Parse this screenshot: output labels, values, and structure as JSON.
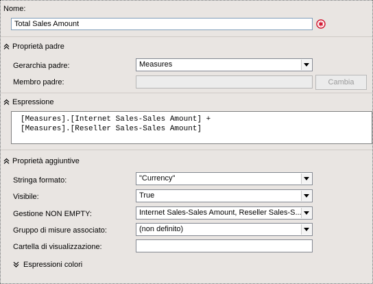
{
  "name_section": {
    "label": "Nome:",
    "value": "Total Sales Amount"
  },
  "parent_section": {
    "header": "Proprietà padre",
    "gerarchia_label": "Gerarchia padre:",
    "gerarchia_value": "Measures",
    "membro_label": "Membro padre:",
    "membro_value": "",
    "change_button": "Cambia"
  },
  "expression_section": {
    "header": "Espressione",
    "line1": "[Measures].[Internet Sales-Sales Amount] +",
    "line2": "[Measures].[Reseller Sales-Sales Amount]"
  },
  "additional_section": {
    "header": "Proprietà aggiuntive",
    "format_label": "Stringa formato:",
    "format_value": "\"Currency\"",
    "visible_label": "Visibile:",
    "visible_value": "True",
    "nonempty_label": "Gestione NON EMPTY:",
    "nonempty_value": "Internet Sales-Sales Amount, Reseller Sales-S...",
    "group_label": "Gruppo di misure associato:",
    "group_value": "(non definito)",
    "folder_label": "Cartella di visualizzazione:",
    "folder_value": "",
    "color_expr_label": "Espressioni colori"
  },
  "colors": {
    "section_bg": "#e9e5e2",
    "error_icon": "#d0102a"
  }
}
